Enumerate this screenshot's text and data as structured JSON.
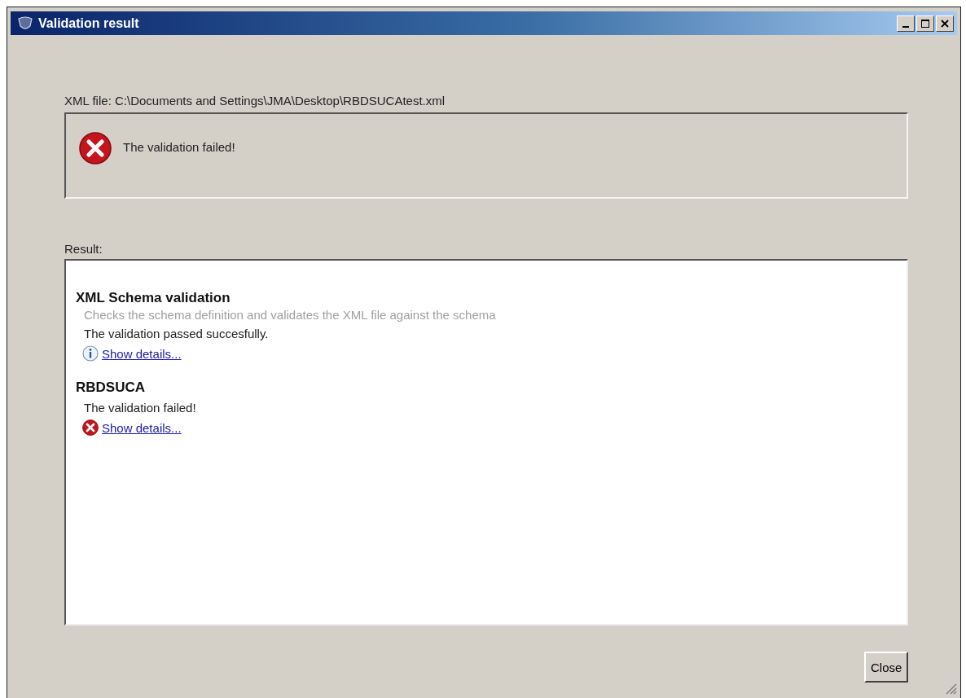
{
  "window": {
    "title": "Validation result"
  },
  "file_label": "XML file: C:\\Documents and Settings\\JMA\\Desktop\\RBDSUCAtest.xml",
  "status": {
    "kind": "error",
    "text": "The validation failed!"
  },
  "result_label": "Result:",
  "results": [
    {
      "title": "XML Schema validation",
      "description": "Checks the schema definition and validates the XML file against the schema",
      "message": "The validation passed succesfully.",
      "kind": "info",
      "link": "Show details..."
    },
    {
      "title": "RBDSUCA",
      "message": "The validation failed!",
      "kind": "error",
      "link": "Show details..."
    }
  ],
  "buttons": [
    "Close"
  ]
}
